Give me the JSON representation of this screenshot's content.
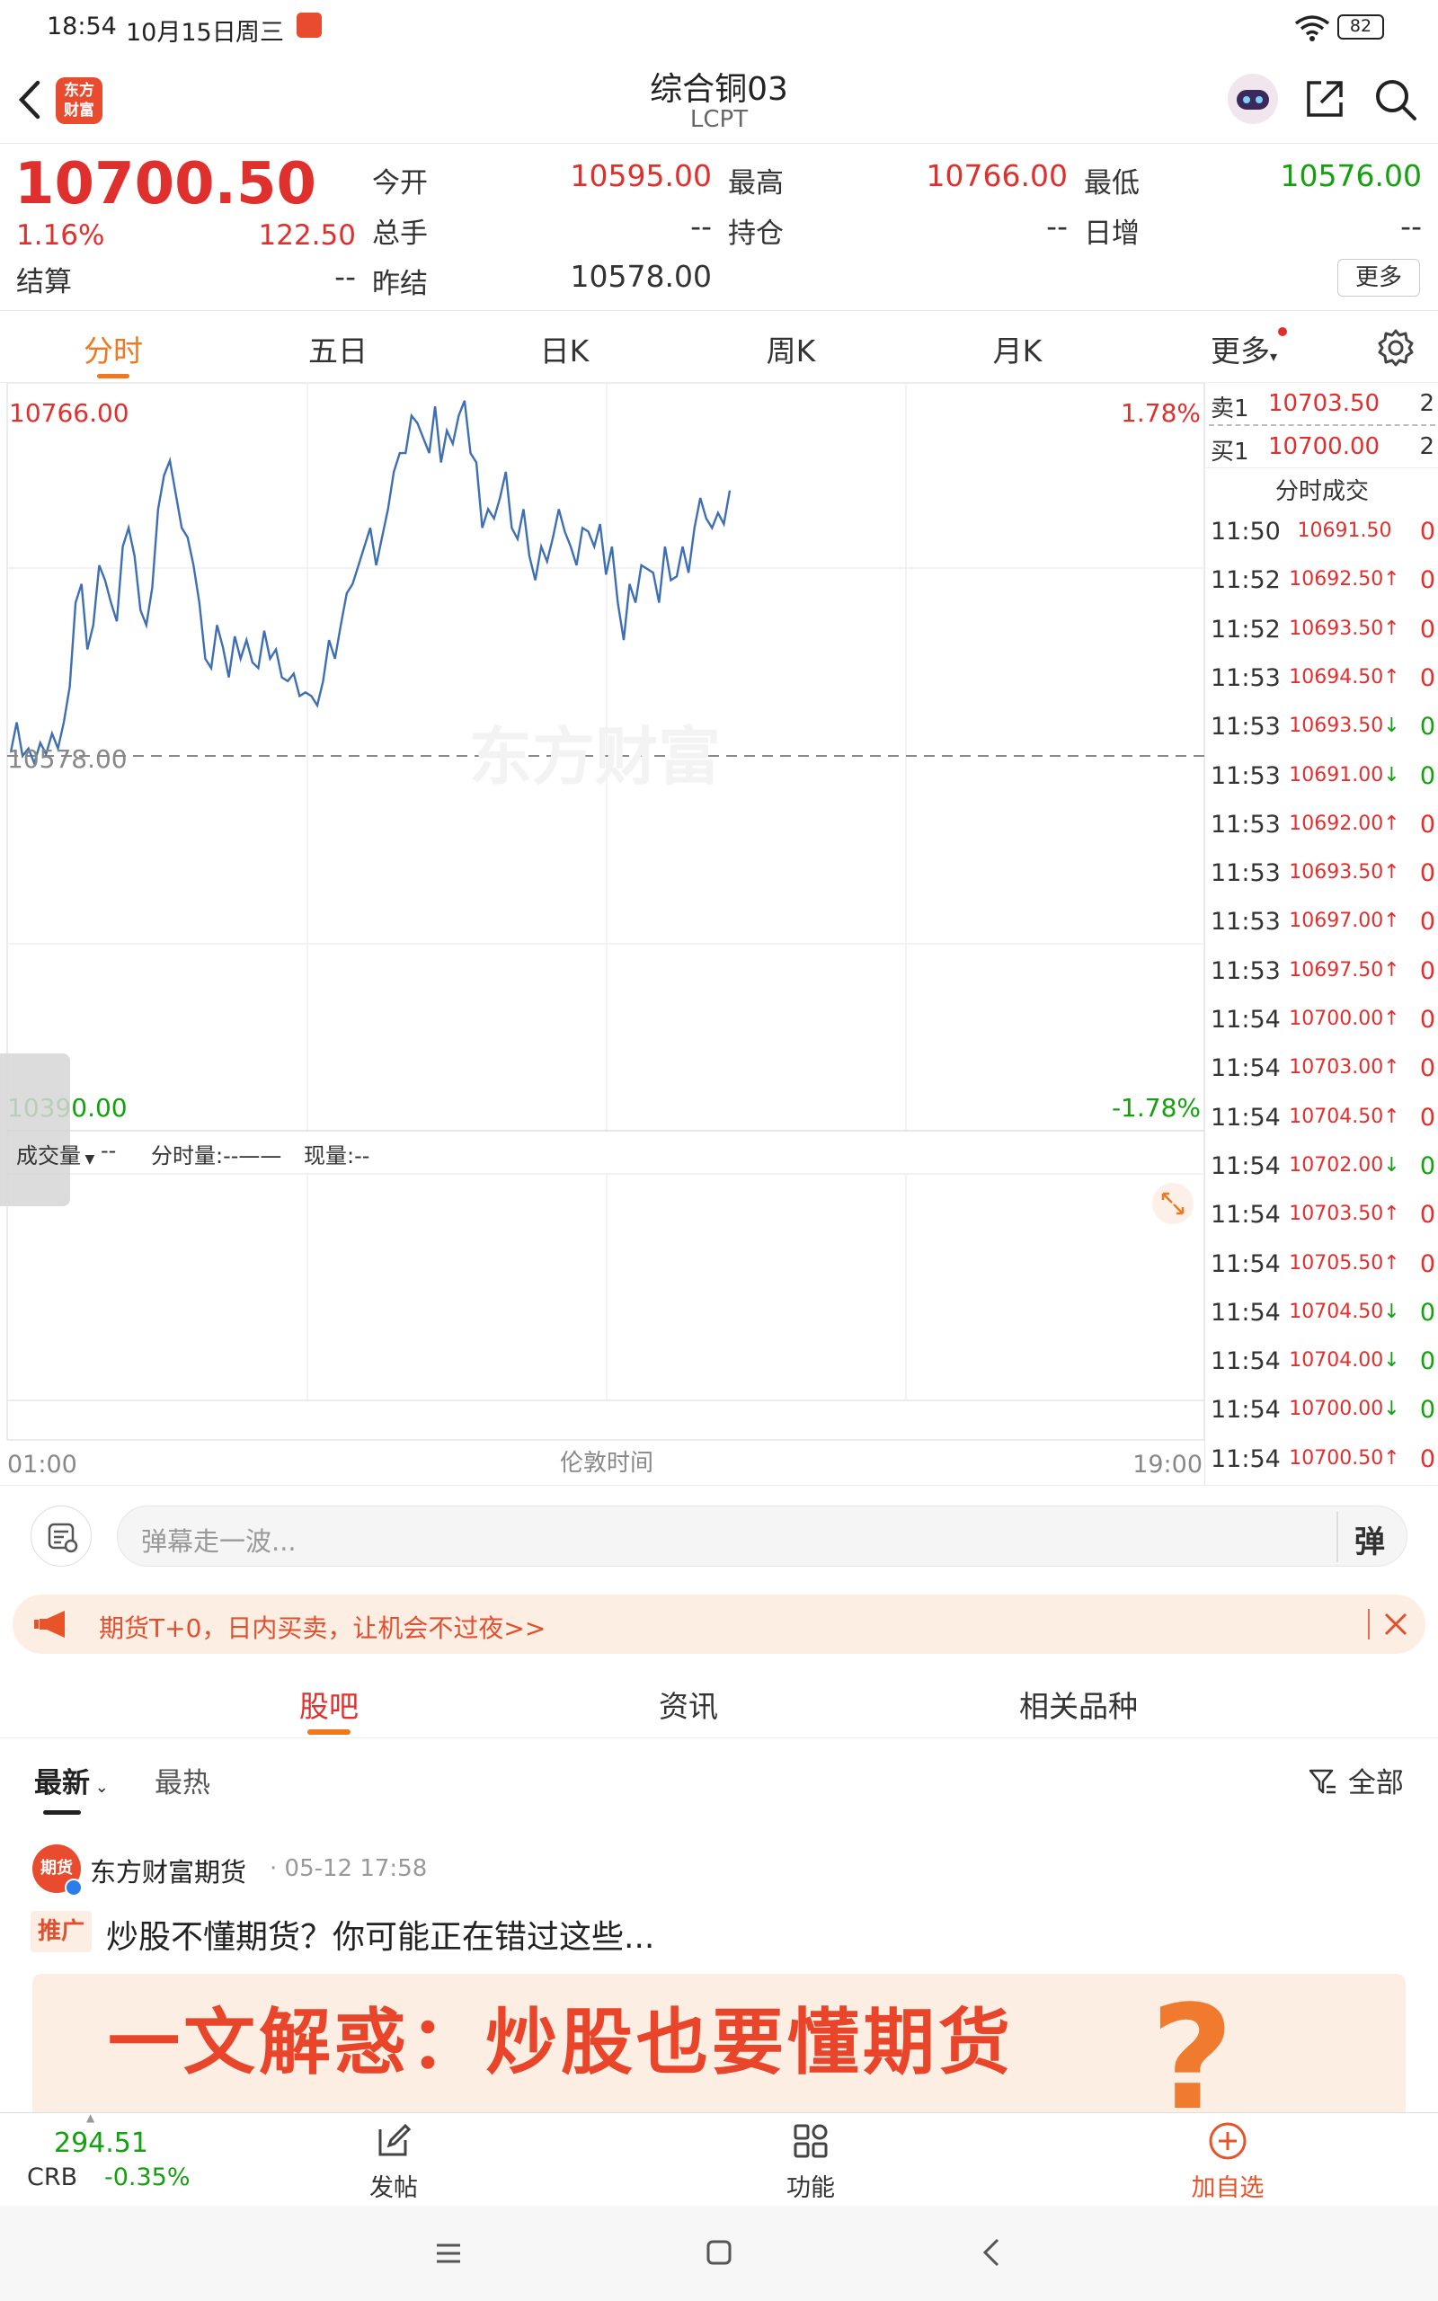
{
  "status_bar": {
    "time": "18:54",
    "date": "10月15日",
    "weekday": "周三",
    "battery": "82"
  },
  "header": {
    "title": "综合铜03",
    "subtitle": "LCPT",
    "logo_text_line1": "东方",
    "logo_text_line2": "财富"
  },
  "quote": {
    "last_price": "10700.50",
    "change_pct": "1.16%",
    "change_abs": "122.50",
    "settle_label": "结算",
    "settle_value": "--",
    "open_label": "今开",
    "open_value": "10595.00",
    "volume_label": "总手",
    "volume_value": "--",
    "prev_settle_label": "昨结",
    "prev_settle_value": "10578.00",
    "high_label": "最高",
    "high_value": "10766.00",
    "position_label": "持仓",
    "position_value": "--",
    "low_label": "最低",
    "low_value": "10576.00",
    "daily_inc_label": "日增",
    "daily_inc_value": "--",
    "more_button": "更多"
  },
  "chart_tabs": [
    "分时",
    "五日",
    "日K",
    "周K",
    "月K",
    "更多"
  ],
  "chart_labels": {
    "y_top": "10766.00",
    "y_mid": "10578.00",
    "y_bottom": "10390.00",
    "pct_top": "1.78%",
    "pct_bottom": "-1.78%",
    "x_start": "01:00",
    "x_mid": "伦敦时间",
    "x_end": "19:00",
    "watermark": "东方财富",
    "vol_selector": "成交量",
    "vol_value": "--",
    "tick_vol_label": "分时量:",
    "tick_vol_value": "--——",
    "cur_vol_label": "现量:",
    "cur_vol_value": "--"
  },
  "chart_data": {
    "type": "line",
    "title": "",
    "xlabel": "伦敦时间",
    "ylabel": "",
    "x_range": [
      "01:00",
      "19:00"
    ],
    "ylim": [
      10390,
      10766
    ],
    "reference_line": 10578,
    "grid": true,
    "series": [
      {
        "values": [
          10580,
          10596,
          10578,
          10582,
          10574,
          10585,
          10579,
          10590,
          10582,
          10596,
          10615,
          10660,
          10670,
          10635,
          10648,
          10680,
          10672,
          10660,
          10650,
          10690,
          10700,
          10685,
          10656,
          10648,
          10668,
          10710,
          10728,
          10736,
          10718,
          10700,
          10695,
          10680,
          10660,
          10630,
          10625,
          10648,
          10636,
          10620,
          10642,
          10630,
          10640,
          10628,
          10625,
          10645,
          10630,
          10635,
          10620,
          10618,
          10622,
          10610,
          10612,
          10610,
          10605,
          10618,
          10640,
          10630,
          10648,
          10665,
          10670,
          10680,
          10690,
          10700,
          10680,
          10695,
          10710,
          10730,
          10740,
          10740,
          10760,
          10756,
          10748,
          10740,
          10765,
          10735,
          10752,
          10745,
          10760,
          10768,
          10740,
          10735,
          10700,
          10710,
          10705,
          10716,
          10730,
          10700,
          10694,
          10710,
          10685,
          10672,
          10690,
          10682,
          10695,
          10710,
          10698,
          10690,
          10680,
          10700,
          10698,
          10690,
          10702,
          10675,
          10690,
          10660,
          10640,
          10670,
          10660,
          10680,
          10678,
          10676,
          10660,
          10690,
          10672,
          10674,
          10690,
          10676,
          10700,
          10716,
          10705,
          10700,
          10708,
          10702,
          10720
        ]
      }
    ]
  },
  "order_book": {
    "sell1_label": "卖1",
    "sell1_price": "10703.50",
    "sell1_vol": "2",
    "buy1_label": "买1",
    "buy1_price": "10700.00",
    "buy1_vol": "2",
    "ticks_title": "分时成交"
  },
  "ticks": [
    {
      "time": "11:50",
      "price": "10691.50",
      "arrow": "",
      "vol": "0"
    },
    {
      "time": "11:52",
      "price": "10692.50",
      "arrow": "↑",
      "vol": "0"
    },
    {
      "time": "11:52",
      "price": "10693.50",
      "arrow": "↑",
      "vol": "0"
    },
    {
      "time": "11:53",
      "price": "10694.50",
      "arrow": "↑",
      "vol": "0"
    },
    {
      "time": "11:53",
      "price": "10693.50",
      "arrow": "↓",
      "vol": "0"
    },
    {
      "time": "11:53",
      "price": "10691.00",
      "arrow": "↓",
      "vol": "0"
    },
    {
      "time": "11:53",
      "price": "10692.00",
      "arrow": "↑",
      "vol": "0"
    },
    {
      "time": "11:53",
      "price": "10693.50",
      "arrow": "↑",
      "vol": "0"
    },
    {
      "time": "11:53",
      "price": "10697.00",
      "arrow": "↑",
      "vol": "0"
    },
    {
      "time": "11:53",
      "price": "10697.50",
      "arrow": "↑",
      "vol": "0"
    },
    {
      "time": "11:54",
      "price": "10700.00",
      "arrow": "↑",
      "vol": "0"
    },
    {
      "time": "11:54",
      "price": "10703.00",
      "arrow": "↑",
      "vol": "0"
    },
    {
      "time": "11:54",
      "price": "10704.50",
      "arrow": "↑",
      "vol": "0"
    },
    {
      "time": "11:54",
      "price": "10702.00",
      "arrow": "↓",
      "vol": "0"
    },
    {
      "time": "11:54",
      "price": "10703.50",
      "arrow": "↑",
      "vol": "0"
    },
    {
      "time": "11:54",
      "price": "10705.50",
      "arrow": "↑",
      "vol": "0"
    },
    {
      "time": "11:54",
      "price": "10704.50",
      "arrow": "↓",
      "vol": "0"
    },
    {
      "time": "11:54",
      "price": "10704.00",
      "arrow": "↓",
      "vol": "0"
    },
    {
      "time": "11:54",
      "price": "10700.00",
      "arrow": "↓",
      "vol": "0"
    },
    {
      "time": "11:54",
      "price": "10700.50",
      "arrow": "↑",
      "vol": "0"
    }
  ],
  "barrage": {
    "placeholder": "弹幕走一波...",
    "toggle": "弹"
  },
  "ad": {
    "text": "期货T+0，日内买卖，让机会不过夜>>"
  },
  "section_tabs": [
    "股吧",
    "资讯",
    "相关品种"
  ],
  "feed": {
    "sort_latest": "最新",
    "sort_hot": "最热",
    "filter": "全部",
    "post_author": "东方财富期货",
    "post_time": "05-12 17:58",
    "post_tag": "推广",
    "post_title": "炒股不懂期货？你可能正在错过这些...",
    "banner_text": "一文解惑：炒股也要懂期货",
    "avatar_text": "期货"
  },
  "bottom_bar": {
    "index_value": "294.51",
    "index_name": "CRB",
    "index_change": "-0.35%",
    "post_label": "发帖",
    "func_label": "功能",
    "add_label": "加自选"
  },
  "colors": {
    "up": "#e0302e",
    "down": "#13a10e",
    "line": "#3e6fb4",
    "accent": "#f0781e"
  }
}
